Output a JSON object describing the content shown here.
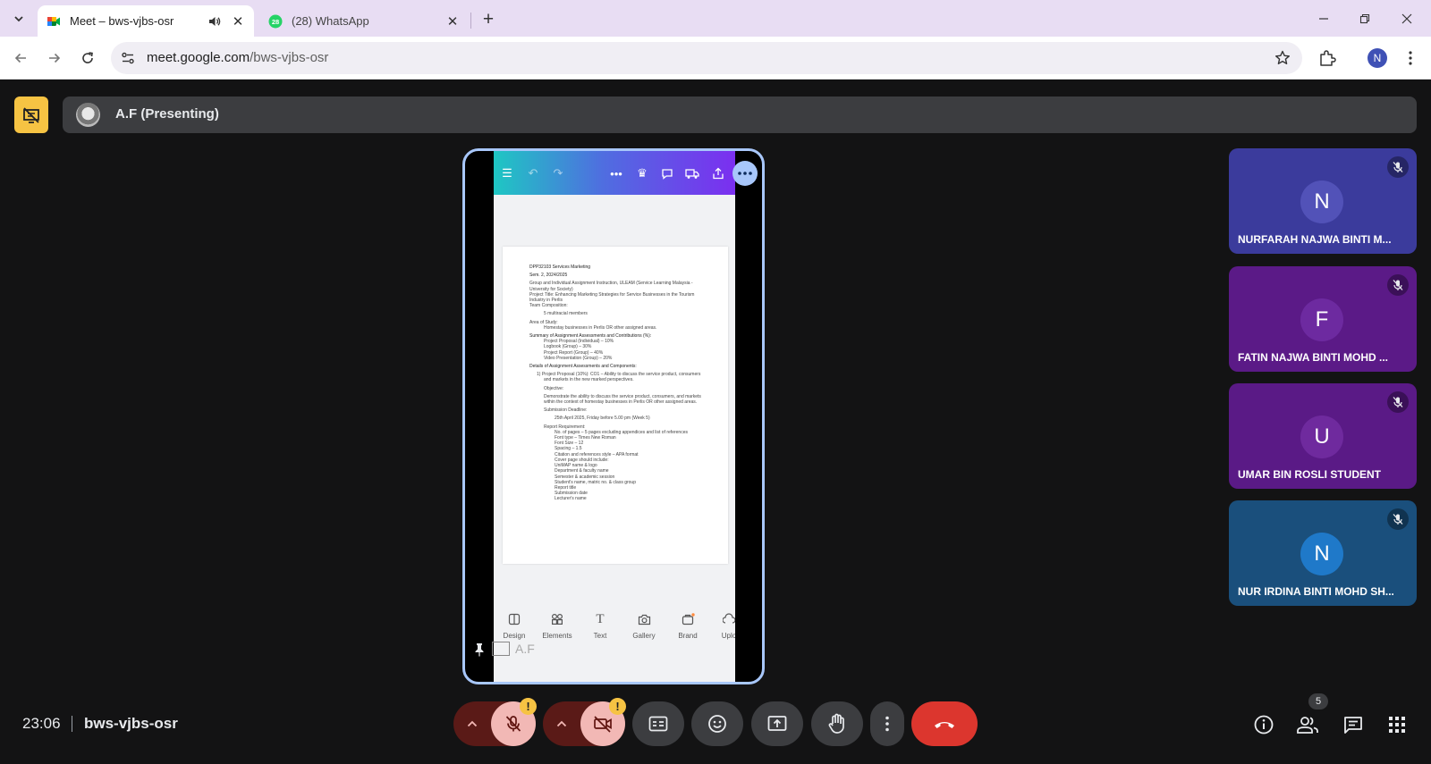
{
  "browser": {
    "tabs": [
      {
        "title": "Meet – bws-vjbs-osr",
        "active": true,
        "audible": true
      },
      {
        "title": "(28) WhatsApp",
        "active": false,
        "badge": "28"
      }
    ],
    "address": {
      "host": "meet.google.com",
      "path": "/bws-vjbs-osr"
    },
    "profile_initial": "N"
  },
  "meet": {
    "presenter_label": "A.F (Presenting)",
    "stage_name": "A.F",
    "shared_doc_lines": [
      "DPP32103 Services Marketing",
      "Sem. 2, 2024/2025",
      "Group and Individual Assignment Instruction, ULEAM (Service Learning Malaysia -",
      "University for Society)",
      "Project Title: Enhancing Marketing Strategies for Service Businesses in the Tourism",
      "Industry in Perlis",
      "Team Composition:",
      "5 multiracial members",
      "Area of Study:",
      "Homestay businesses in Perlis OR other assigned areas.",
      "Summary of Assignment Assessments and Contributions (%):",
      "Project Proposal (Individual) – 10%",
      "Logbook (Group) – 30%",
      "Project Report (Group) – 40%",
      "Video Presentation (Group) – 20%",
      "Details of Assignment Assessments and Components:",
      "1) Project Proposal (10%): CO1 – Ability to discuss the service product, consumers",
      "and markets in the new marked perspectives.",
      "Objective:",
      "Demonstrate the ability to discuss the service product, consumers, and markets",
      "within the context of homestay businesses in Perlis OR other assigned areas.",
      "Submission Deadline:",
      "25th April 2025, Friday before 5.00 pm (Week 5)",
      "Report Requirement:",
      "No. of pages – 5 pages excluding appendices and list of references",
      "Font type – Times New Roman",
      "Font Size – 12",
      "Spacing – 1.5",
      "Citation and references style – APA format",
      "Cover page should include:",
      "UniMAP name & logo",
      "Department & faculty name",
      "Semester & academic session",
      "Student's name, matric no. & class group",
      "Report title",
      "Submission date",
      "Lecturer's name"
    ],
    "canva_nav": [
      "Design",
      "Elements",
      "Text",
      "Gallery",
      "Brand",
      "Uplo"
    ],
    "participants": [
      {
        "initial": "N",
        "name": "NURFARAH NAJWA BINTI M...",
        "bg": "#3b3b9c",
        "circle": "#5252b8"
      },
      {
        "initial": "F",
        "name": "FATIN NAJWA BINTI MOHD ...",
        "bg": "#5b1a87",
        "circle": "#6d2aa0"
      },
      {
        "initial": "U",
        "name": "UMAR BIN ROSLI STUDENT",
        "bg": "#5a1a86",
        "circle": "#6f2a9e"
      },
      {
        "initial": "N",
        "name": "NUR IRDINA BINTI MOHD SH...",
        "bg": "#1a4f7c",
        "circle": "#1f79c9"
      }
    ],
    "clock": "23:06",
    "meeting_code": "bws-vjbs-osr",
    "people_count": "5"
  }
}
